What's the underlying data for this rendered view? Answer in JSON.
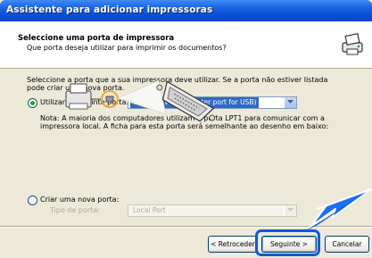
{
  "window": {
    "title": "Assistente para adicionar impressoras"
  },
  "header": {
    "title": "Seleccione uma porta de impressora",
    "subtitle": "Que porta deseja utilizar para imprimir os documentos?",
    "icon": "printer-wizard-icon"
  },
  "body": {
    "intro_line1": "Seleccione a porta que a sua impressora deve utilizar. Se a porta não estiver listada",
    "intro_line2": "pode criar uma nova porta.",
    "use_port": {
      "label": "Utilizar a seguinte porta:",
      "selected": true,
      "value": "USB001 (Virtual printer port for USB)"
    },
    "note_line1": "Nota: A maioria dos computadores utilizam a porta LPT1 para comunicar com a",
    "note_line2": "impressora local. A ficha para esta porta será semelhante ao desenho em baixo:",
    "new_port": {
      "label": "Criar uma nova porta:",
      "selected": false,
      "type_label": "Tipo de porta:",
      "type_value": "Local Port"
    }
  },
  "buttons": {
    "back": "< Retroceder",
    "next": "Seguinte >",
    "cancel": "Cancelar"
  },
  "colors": {
    "titlebar": "#0a4fd6",
    "highlight": "#0b5bd5",
    "selection": "#316ac5",
    "orange_circle": "#f2a33a"
  }
}
